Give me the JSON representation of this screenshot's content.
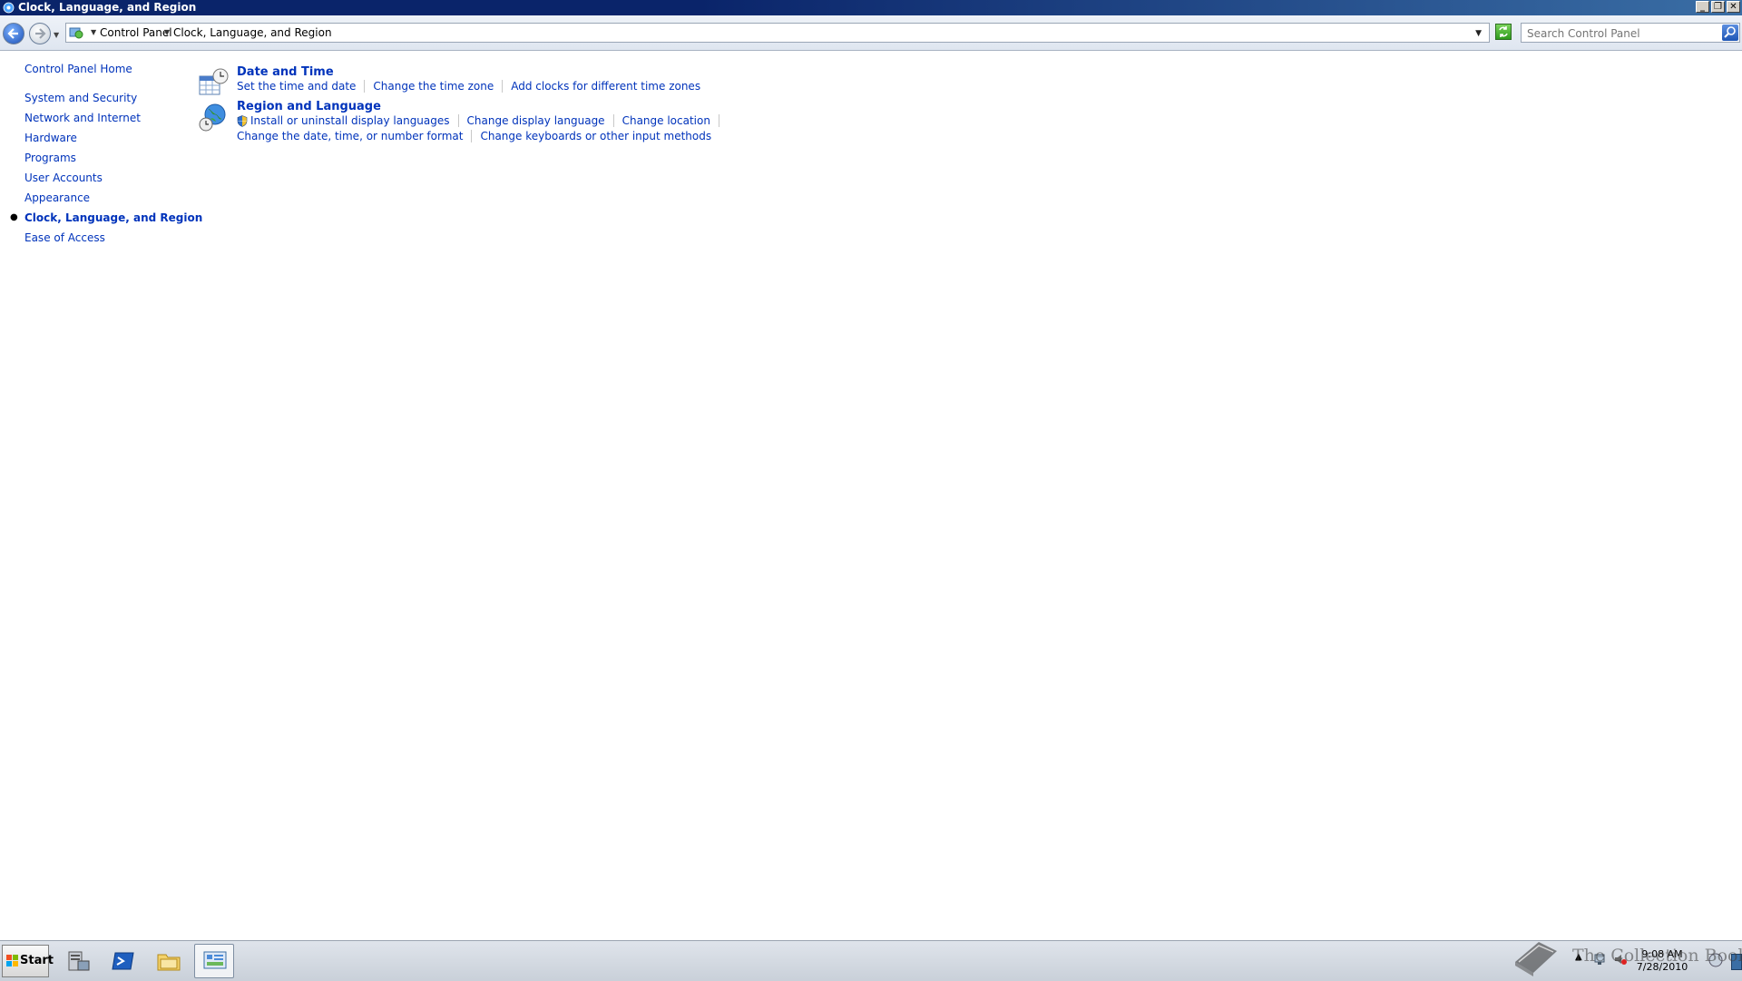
{
  "window": {
    "title": "Clock, Language, and Region",
    "buttons": {
      "minimize": "_",
      "restore": "❐",
      "close": "✕"
    }
  },
  "address_bar": {
    "breadcrumb": [
      "Control Panel",
      "Clock, Language, and Region"
    ],
    "search_placeholder": "Search Control Panel"
  },
  "left_nav": {
    "home": "Control Panel Home",
    "items": [
      "System and Security",
      "Network and Internet",
      "Hardware",
      "Programs",
      "User Accounts",
      "Appearance",
      "Clock, Language, and Region",
      "Ease of Access"
    ],
    "active_index": 6
  },
  "categories": [
    {
      "title": "Date and Time",
      "icon": "calendar-clock-icon",
      "rows": [
        [
          "Set the time and date",
          "Change the time zone",
          "Add clocks for different time zones"
        ]
      ]
    },
    {
      "title": "Region and Language",
      "icon": "globe-clock-icon",
      "rows": [
        [
          "Install or uninstall display languages",
          "Change display language",
          "Change location"
        ],
        [
          "Change the date, time, or number format",
          "Change keyboards or other input methods"
        ]
      ]
    }
  ],
  "taskbar": {
    "start_label": "Start",
    "apps": [
      "server-manager-icon",
      "powershell-icon",
      "explorer-icon",
      "control-panel-icon"
    ],
    "active_app": "control-panel-icon",
    "clock_time": "9:08 AM",
    "clock_date": "7/28/2010"
  },
  "watermark": "The Collection Book",
  "colors": {
    "link": "#0033bb",
    "titlebar": "#0a246a"
  }
}
